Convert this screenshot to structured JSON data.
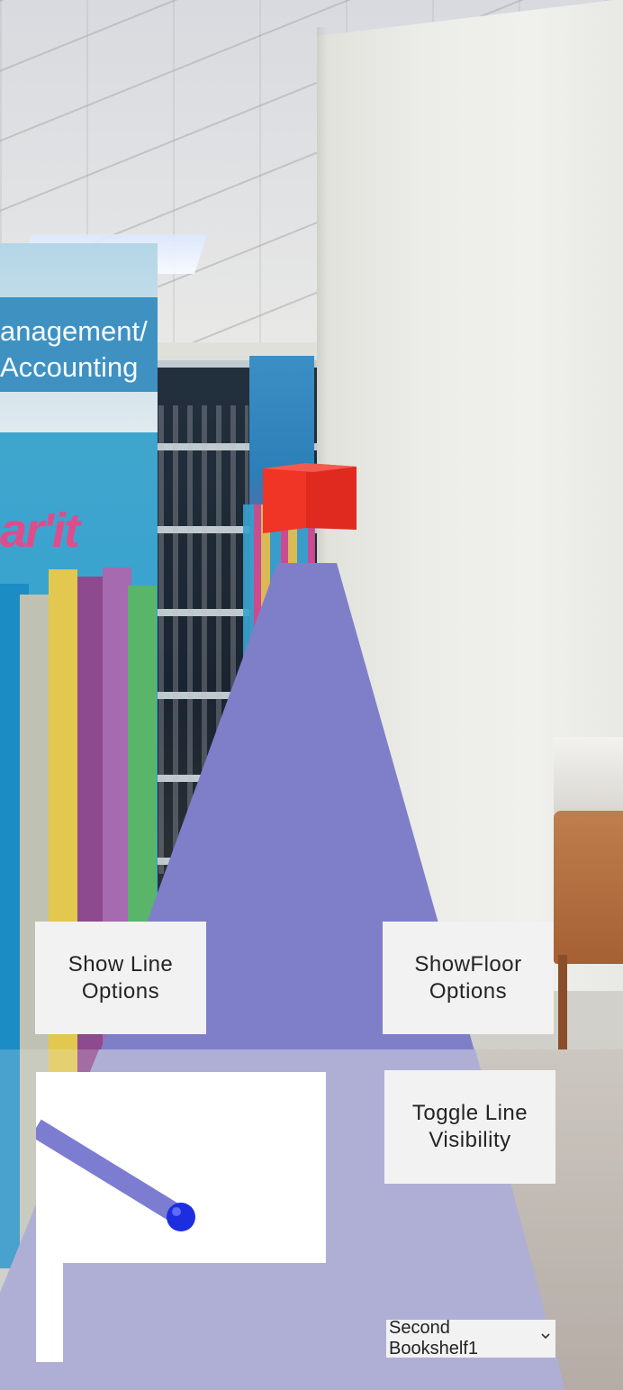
{
  "scene": {
    "backdrop_sign": {
      "line1": "anagement/",
      "line2": "Accounting",
      "logo": "ar'it"
    }
  },
  "ar_overlay": {
    "path_color": "#7f7fc9",
    "target_marker_color": "#e8332a",
    "user_marker_color": "#1d2ee0"
  },
  "controls": {
    "show_line_options": "Show Line\nOptions",
    "show_floor_options": "ShowFloor\nOptions",
    "toggle_line_visibility": "Toggle Line\nVisibility"
  },
  "destination_select": {
    "selected": "Second\nBookshelf1",
    "icon": "chevron-down-icon"
  }
}
